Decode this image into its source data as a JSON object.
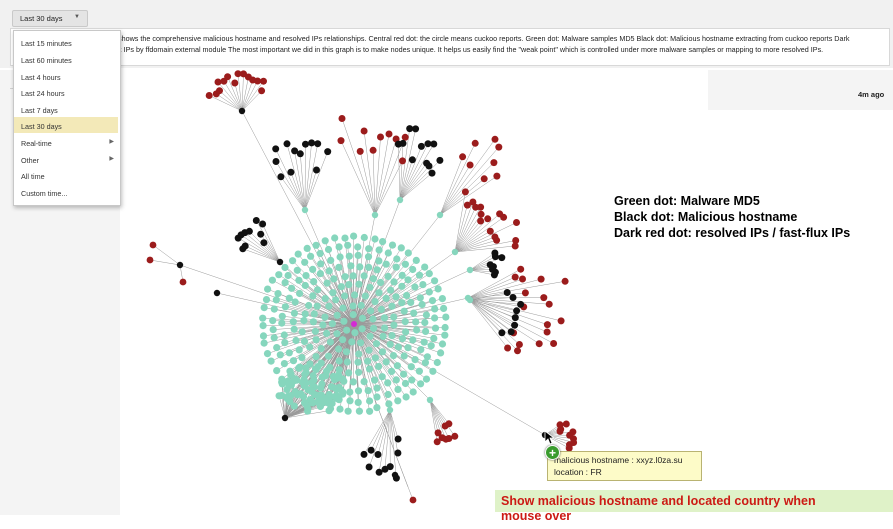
{
  "time_range": {
    "button_label": "Last 30 days",
    "options": [
      "Last 15 minutes",
      "Last 60 minutes",
      "Last 4 hours",
      "Last 24 hours",
      "Last 7 days",
      "Last 30 days",
      "Real-time",
      "Other",
      "All time",
      "Custom time..."
    ],
    "selected": "Last 30 days"
  },
  "description": {
    "line1": "shows the comprehensive malicious hostname and resolved IPs relationships. Central red dot: the circle means cuckoo reports. Green dot: Malware samples MD5 Black dot: Malicious hostname extracting from cuckoo reports Dark",
    "line2": "x IPs by ffdomain external module The most important we did in this graph is to make nodes unique. It helps us easily find the \"weak point\" which is controlled under more malware samples or mapping to more resolved IPs."
  },
  "time_ago": "4m ago",
  "legend": {
    "green": "Green dot: Malware MD5",
    "black": "Black dot:  Malicious hostname",
    "red": "Dark red dot: resolved IPs / fast-flux IPs"
  },
  "tooltip": {
    "hostname_line": "malicious hostname : xxyz.l0za.su",
    "location_line": "location : FR"
  },
  "caption": {
    "line1": "Show  malicious hostname and located country when",
    "line2": "mouse over"
  },
  "colors": {
    "green": "#86d6bd",
    "black": "#111111",
    "red": "#9b1c1c",
    "center": "#d42ad4",
    "edge": "#9a9a9a"
  }
}
